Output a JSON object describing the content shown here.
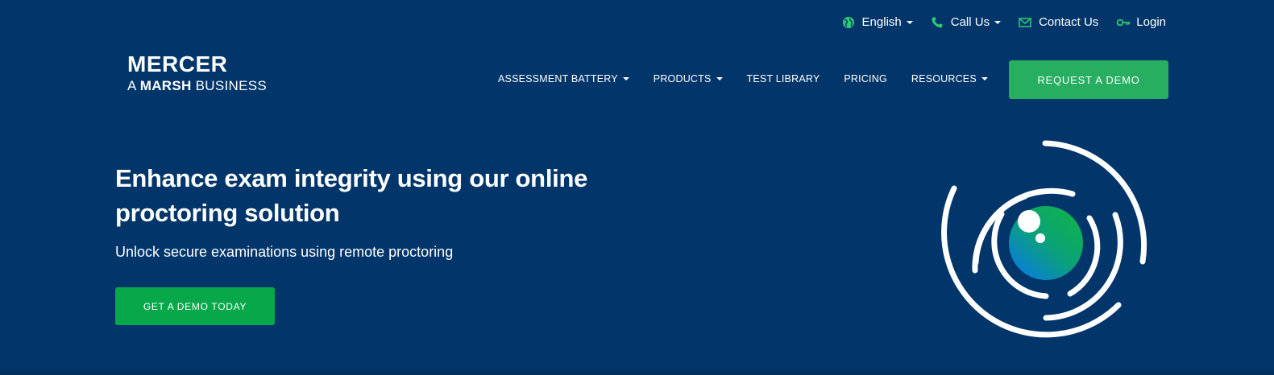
{
  "utility_nav": {
    "language": {
      "label": "English",
      "icon": "globe-icon"
    },
    "call": {
      "label": "Call Us",
      "icon": "phone-icon"
    },
    "contact": {
      "label": "Contact Us",
      "icon": "envelope-icon"
    },
    "login": {
      "label": "Login",
      "icon": "key-icon"
    }
  },
  "logo": {
    "name": "MERCER",
    "tagline_prefix": "A",
    "tagline_bold": "MARSH",
    "tagline_suffix": "BUSINESS"
  },
  "main_nav": {
    "items": [
      {
        "label": "ASSESSMENT BATTERY",
        "has_dropdown": true
      },
      {
        "label": "PRODUCTS",
        "has_dropdown": true
      },
      {
        "label": "TEST LIBRARY",
        "has_dropdown": false
      },
      {
        "label": "PRICING",
        "has_dropdown": false
      },
      {
        "label": "RESOURCES",
        "has_dropdown": true
      }
    ],
    "cta_label": "REQUEST A DEMO"
  },
  "hero": {
    "title": "Enhance exam integrity using our online proctoring solution",
    "subtitle": "Unlock secure examinations using remote proctoring",
    "cta_label": "GET A DEMO TODAY",
    "graphic_icon": "proctoring-eye-icon"
  },
  "colors": {
    "background": "#02366a",
    "accent_green": "#27ae60",
    "hero_button_green": "#07a84a",
    "icon_green": "#2ecc71"
  }
}
